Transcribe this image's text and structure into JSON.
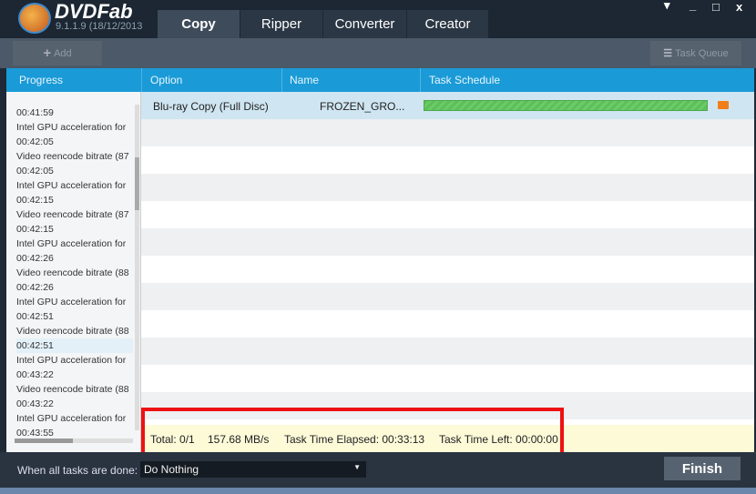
{
  "app": {
    "brand": "DVDFab",
    "version": "9.1.1.9 (18/12/2013"
  },
  "tabs": [
    {
      "label": "Copy"
    },
    {
      "label": "Ripper"
    },
    {
      "label": "Converter"
    },
    {
      "label": "Creator"
    }
  ],
  "toolbar": {
    "add_label": "Add",
    "task_queue_label": "Task Queue"
  },
  "columns": {
    "progress": "Progress",
    "option": "Option",
    "name": "Name",
    "schedule": "Task Schedule"
  },
  "log": [
    "00:41:59",
    "Intel GPU acceleration for",
    "00:42:05",
    "Video reencode bitrate (87",
    "00:42:05",
    "Intel GPU acceleration for",
    "00:42:15",
    "Video reencode bitrate (87",
    "00:42:15",
    "Intel GPU acceleration for",
    "00:42:26",
    "Video reencode bitrate (88",
    "00:42:26",
    "Intel GPU acceleration for",
    "00:42:51",
    "Video reencode bitrate (88",
    "00:42:51",
    "Intel GPU acceleration for",
    "00:43:22",
    "Video reencode bitrate (88",
    "00:43:22",
    "Intel GPU acceleration for",
    "00:43:55"
  ],
  "task": {
    "option": "Blu-ray Copy (Full Disc)",
    "name": "FROZEN_GRO...",
    "progress_percent": 100
  },
  "status": {
    "total": "Total: 0/1",
    "speed": "157.68 MB/s",
    "elapsed": "Task Time Elapsed: 00:33:13",
    "left": "Task Time Left: 00:00:00"
  },
  "bottom": {
    "label": "When all tasks are done:",
    "action": "Do Nothing",
    "finish": "Finish"
  },
  "colors": {
    "header_blue": "#1a9bd7",
    "progress_green": "#5cbf5a",
    "highlight_red": "#ee1111"
  }
}
